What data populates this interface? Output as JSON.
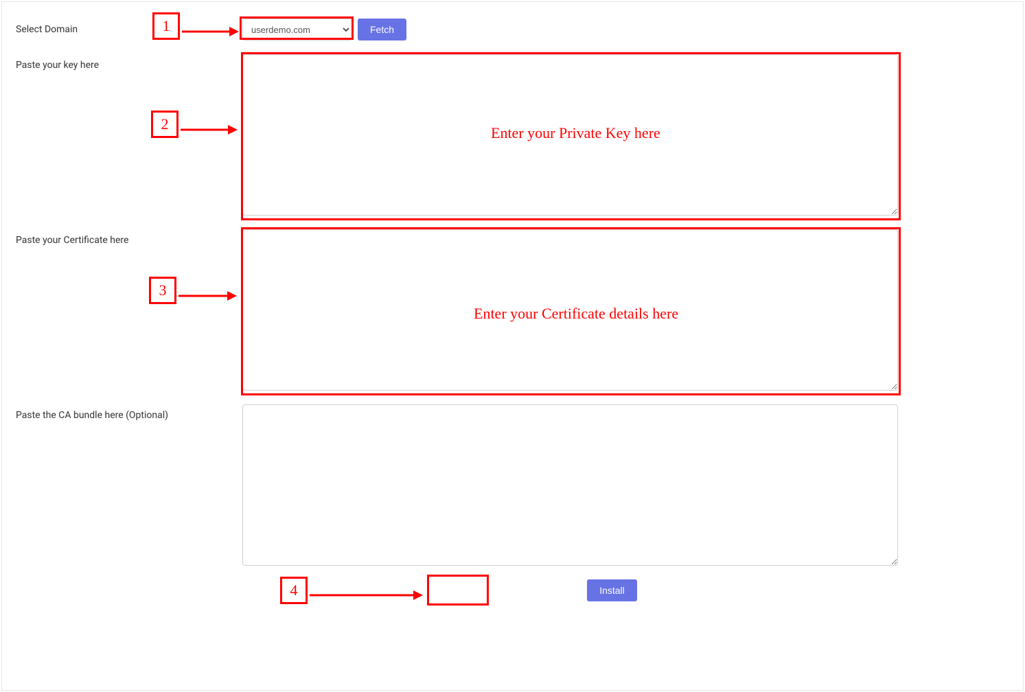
{
  "form": {
    "domain": {
      "label": "Select Domain",
      "selected": "userdemo.com",
      "fetch_button": "Fetch"
    },
    "key": {
      "label": "Paste your key here"
    },
    "cert": {
      "label": "Paste your Certificate here"
    },
    "ca_bundle": {
      "label": "Paste the CA bundle here (Optional)"
    },
    "install_button": "Install"
  },
  "annotations": {
    "step1": "1",
    "step2": "2",
    "step3": "3",
    "step4": "4",
    "key_hint": "Enter your Private Key here",
    "cert_hint": "Enter your Certificate details here"
  }
}
